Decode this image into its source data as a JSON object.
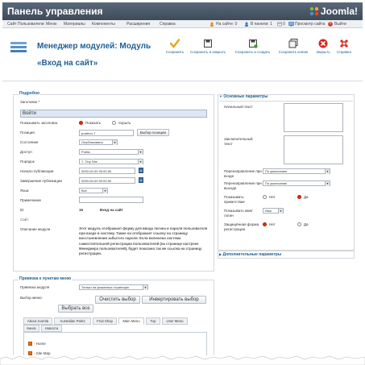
{
  "header": {
    "title": "Панель управления",
    "brand": "Joomla!"
  },
  "menu": {
    "items": [
      "Сайт",
      "Пользователи",
      "Меню",
      "Материалы",
      "Компоненты",
      "Расширения",
      "Справка"
    ],
    "status": {
      "site": "На сайте: 0",
      "panel": "В панели: 1",
      "count": "0",
      "preview": "Просмотр сайта",
      "logout": "Выйти"
    }
  },
  "toolbar": {
    "title_line1": "Менеджер модулей: Модуль",
    "title_line2": "«Вход на сайт»",
    "buttons": [
      "Сохранить",
      "Сохранить и закрыть",
      "Сохранить и создать",
      "Сохранить копию",
      "Закрыть",
      "Справка"
    ]
  },
  "details": {
    "legend": "Подробно",
    "title_label": "Заголовок",
    "title_value": "Войти",
    "show_title_label": "Показывать заголовок",
    "show_title_on": "Показать",
    "show_title_off": "Скрыть",
    "position_label": "Позиция",
    "position_value": "position-7",
    "position_button": "Выбор позиции",
    "state_label": "Состояние",
    "state_value": "Опубликовано",
    "access_label": "Доступ",
    "access_value": "Public",
    "order_label": "Порядок",
    "order_value": "7. Tiny Site",
    "publish_up_label": "Начало публикации",
    "publish_up_value": "0000-00-00 00:00:00",
    "publish_down_label": "Завершение публикации",
    "publish_down_value": "0000-00-00 00:00:00",
    "language_label": "Язык",
    "language_value": "Все",
    "note_label": "Примечание",
    "id_label": "ID",
    "id_value": "16",
    "id_name": "Вход на сайт",
    "site_label": "Сайт",
    "desc_label": "Описание модуля",
    "desc_text": "Этот модуль отображает форму для ввода логина и пароля пользователя при входе в систему. Также он отображает ссылку на страницу восстановления забытого пароля. Если включена система самостоятельной регистрации пользователей (на странице настроек Менеджера пользователей), будет показана так же ссылка на страницу регистрации."
  },
  "params": {
    "basic_header": "Основные параметры",
    "pre_text_label": "Начальный текст",
    "post_text_label": "Заключительный текст",
    "login_redirect_label": "Перенаправление при входе",
    "login_redirect_value": "По умолчанию",
    "logout_redirect_label": "Перенаправление при выходе",
    "logout_redirect_value": "По умолчанию",
    "greeting_label": "Показывать приветствие",
    "greeting_no": "Нет",
    "greeting_yes": "Да",
    "name_label": "Показывать имя/логин",
    "name_value": "Имя",
    "secure_label": "Защищённая форма регистрации",
    "secure_no": "Нет",
    "secure_yes": "Да",
    "advanced_header": "Дополнительные параметры"
  },
  "assignment": {
    "legend": "Привязка к пунктам меню",
    "module_assign_label": "Привязка модуля",
    "module_assign_value": "Только на указанных страницах",
    "choose_label": "Выбор меню:",
    "clear_button": "Очистить выбор",
    "invert_button": "Инвертировать выбор",
    "select_all_button": "Выбрать все",
    "tabs": [
      "About Joomla",
      "Australian Parks",
      "Fruit Shop",
      "Main Menu",
      "Top",
      "User Menu",
      "Книга",
      "Новости"
    ],
    "active_tab": "Main Menu",
    "items": [
      "- Home",
      "- Site Map"
    ]
  }
}
